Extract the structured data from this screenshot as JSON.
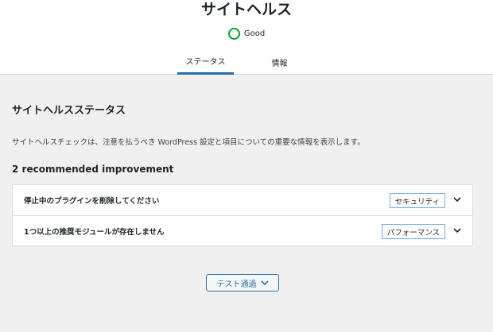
{
  "header": {
    "title": "サイトヘルス",
    "status_text": "Good",
    "status_color": "#00a32a"
  },
  "tabs": [
    {
      "label": "ステータス",
      "active": true
    },
    {
      "label": "情報",
      "active": false
    }
  ],
  "main": {
    "section_title": "サイトヘルスステータス",
    "description": "サイトヘルスチェックは、注意を払うべき WordPress 設定と項目についての重要な情報を表示します。",
    "recommended_heading": "2 recommended improvement",
    "issues": [
      {
        "label": "停止中のプラグインを削除してください",
        "badge": "セキュリティ",
        "icon": "chevron-down-icon"
      },
      {
        "label": "1つ以上の推奨モジュールが存在しません",
        "badge": "パフォーマンス",
        "icon": "chevron-down-icon"
      }
    ],
    "passed_button_label": "テスト通過"
  },
  "colors": {
    "accent": "#2271b1",
    "badge_border": "#72aee6",
    "background": "#f0f0f1"
  }
}
